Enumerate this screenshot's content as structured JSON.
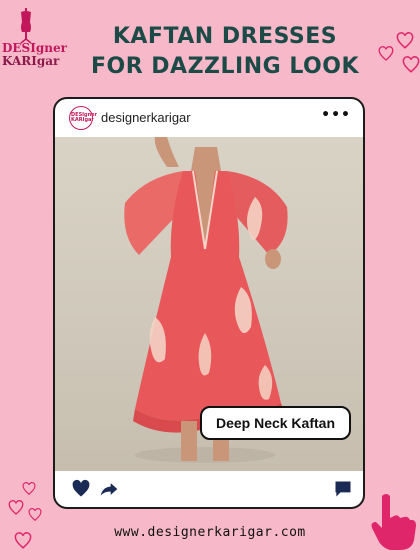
{
  "brand": {
    "logo_line1": "DESIgner",
    "logo_line2": "KARIgar"
  },
  "headline": {
    "line1": "KAFTAN DRESSES",
    "line2": "FOR DAZZLING LOOK"
  },
  "post": {
    "avatar_text": "DESIgner KARIgar",
    "username": "designerkarigar",
    "more_icon": "more-horizontal-icon",
    "tag_label": "Deep Neck Kaftan",
    "footer_icons": [
      "heart-icon",
      "share-icon",
      "comment-icon"
    ]
  },
  "footer": {
    "website": "www.designerkarigar.com"
  },
  "colors": {
    "background": "#f7b8c9",
    "headline": "#1b4a47",
    "accent": "#c2185b",
    "dress": "#e8585a"
  }
}
